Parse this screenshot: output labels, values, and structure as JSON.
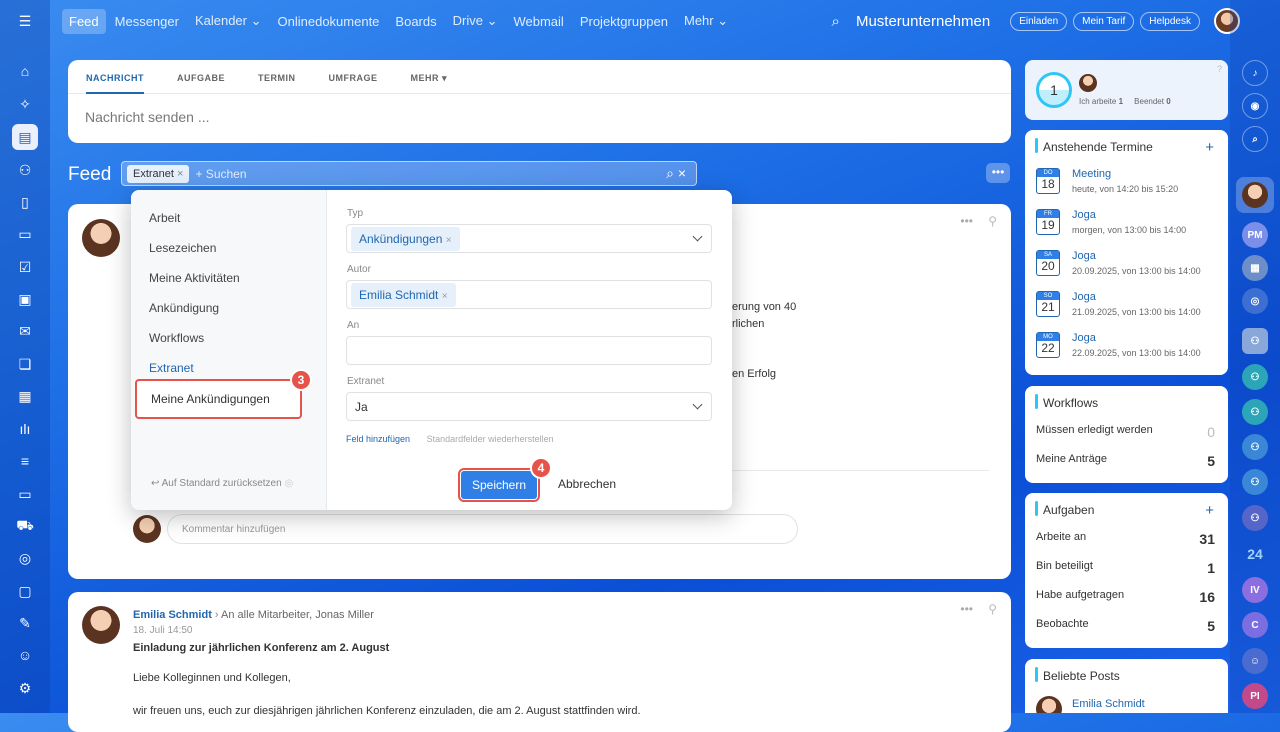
{
  "nav": [
    "Feed",
    "Messenger",
    "Kalender",
    "Onlinedokumente",
    "Boards",
    "Drive",
    "Webmail",
    "Projektgruppen",
    "Mehr"
  ],
  "company": "Musterunternehmen",
  "top_buttons": [
    "Einladen",
    "Mein Tarif",
    "Helpdesk"
  ],
  "post_tabs": [
    "NACHRICHT",
    "AUFGABE",
    "TERMIN",
    "UMFRAGE",
    "MEHR"
  ],
  "post_placeholder": "Nachricht senden ...",
  "feed_title": "Feed",
  "search": {
    "chip": "Extranet",
    "placeholder": "+ Suchen"
  },
  "filter": {
    "presets": [
      "Arbeit",
      "Lesezeichen",
      "Meine Aktivitäten",
      "Ankündigung",
      "Workflows",
      "Extranet"
    ],
    "new_preset": "Meine Ankündigungen",
    "reset": "Auf Standard zurücksetzen",
    "typ_label": "Typ",
    "typ_value": "Ankündigungen",
    "autor_label": "Autor",
    "autor_value": "Emilia Schmidt",
    "an_label": "An",
    "extranet_label": "Extranet",
    "extranet_value": "Ja",
    "add_field": "Feld hinzufügen",
    "restore": "Standardfelder wiederherstellen",
    "save": "Speichern",
    "cancel": "Abbrechen"
  },
  "steps": [
    "3",
    "4"
  ],
  "post1": {
    "frag1": "erung von 40",
    "frag2": "rlichen",
    "frag3": "en Erfolg",
    "comment_ph": "Kommentar hinzufügen"
  },
  "post2": {
    "author": "Emilia Schmidt",
    "to": "An alle Mitarbeiter, Jonas Miller",
    "date": "18. Juli 14:50",
    "title": "Einladung zur jährlichen Konferenz am 2. August",
    "line1": "Liebe Kolleginnen und Kollegen,",
    "line2": "wir freuen uns, euch zur diesjährigen jährlichen Konferenz einzuladen, die am 2. August stattfinden wird."
  },
  "status": {
    "count": "1",
    "working": "Ich arbeite",
    "working_n": "1",
    "ended": "Beendet",
    "ended_n": "0"
  },
  "termine": {
    "title": "Anstehende Termine",
    "items": [
      {
        "day": "DO",
        "date": "18",
        "title": "Meeting",
        "time": "heute, von 14:20 bis 15:20"
      },
      {
        "day": "FR",
        "date": "19",
        "title": "Joga",
        "time": "morgen, von 13:00 bis 14:00"
      },
      {
        "day": "SA",
        "date": "20",
        "title": "Joga",
        "time": "20.09.2025, von 13:00 bis 14:00"
      },
      {
        "day": "SO",
        "date": "21",
        "title": "Joga",
        "time": "21.09.2025, von 13:00 bis 14:00"
      },
      {
        "day": "MO",
        "date": "22",
        "title": "Joga",
        "time": "22.09.2025, von 13:00 bis 14:00"
      }
    ]
  },
  "workflows": {
    "title": "Workflows",
    "rows": [
      {
        "label": "Müssen erledigt werden",
        "n": "0"
      },
      {
        "label": "Meine Anträge",
        "n": "5"
      }
    ]
  },
  "aufgaben": {
    "title": "Aufgaben",
    "rows": [
      {
        "label": "Arbeite an",
        "n": "31"
      },
      {
        "label": "Bin beteiligt",
        "n": "1"
      },
      {
        "label": "Habe aufgetragen",
        "n": "16"
      },
      {
        "label": "Beobachte",
        "n": "5"
      }
    ]
  },
  "beliebte": {
    "title": "Beliebte Posts",
    "author": "Emilia Schmidt"
  },
  "right_badges": [
    "PM",
    "24",
    "IV",
    "C",
    "PI"
  ]
}
